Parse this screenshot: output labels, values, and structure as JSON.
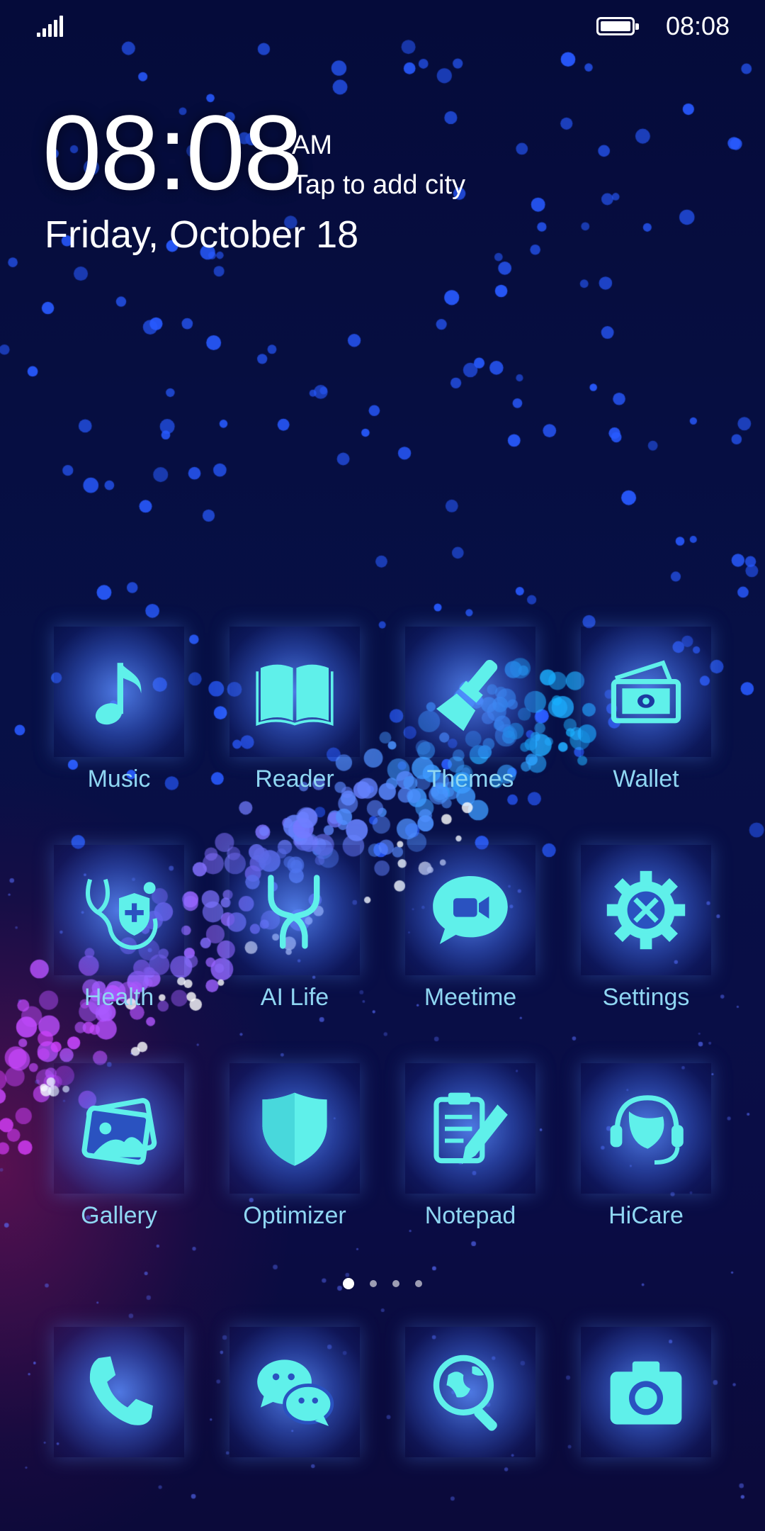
{
  "status_bar": {
    "time": "08:08"
  },
  "clock": {
    "time": "08:08",
    "ampm": "AM",
    "city_prompt": "Tap to add city",
    "date": "Friday, October 18"
  },
  "apps": [
    {
      "label": "Music",
      "icon": "music-note-icon"
    },
    {
      "label": "Reader",
      "icon": "book-icon"
    },
    {
      "label": "Themes",
      "icon": "paintbrush-icon"
    },
    {
      "label": "Wallet",
      "icon": "wallet-icon"
    },
    {
      "label": "Health",
      "icon": "stethoscope-icon"
    },
    {
      "label": "AI Life",
      "icon": "ai-life-icon"
    },
    {
      "label": "Meetime",
      "icon": "video-chat-icon"
    },
    {
      "label": "Settings",
      "icon": "gear-icon"
    },
    {
      "label": "Gallery",
      "icon": "gallery-icon"
    },
    {
      "label": "Optimizer",
      "icon": "shield-icon"
    },
    {
      "label": "Notepad",
      "icon": "notepad-icon"
    },
    {
      "label": "HiCare",
      "icon": "headset-icon"
    }
  ],
  "dock": [
    {
      "icon": "phone-icon"
    },
    {
      "icon": "messaging-icon"
    },
    {
      "icon": "browser-icon"
    },
    {
      "icon": "camera-icon"
    }
  ],
  "pager": {
    "pages": 4,
    "current": 1
  },
  "colors": {
    "icon_glyph": "#5ff0ea",
    "label": "#8fd6f2",
    "background": "#071046"
  }
}
